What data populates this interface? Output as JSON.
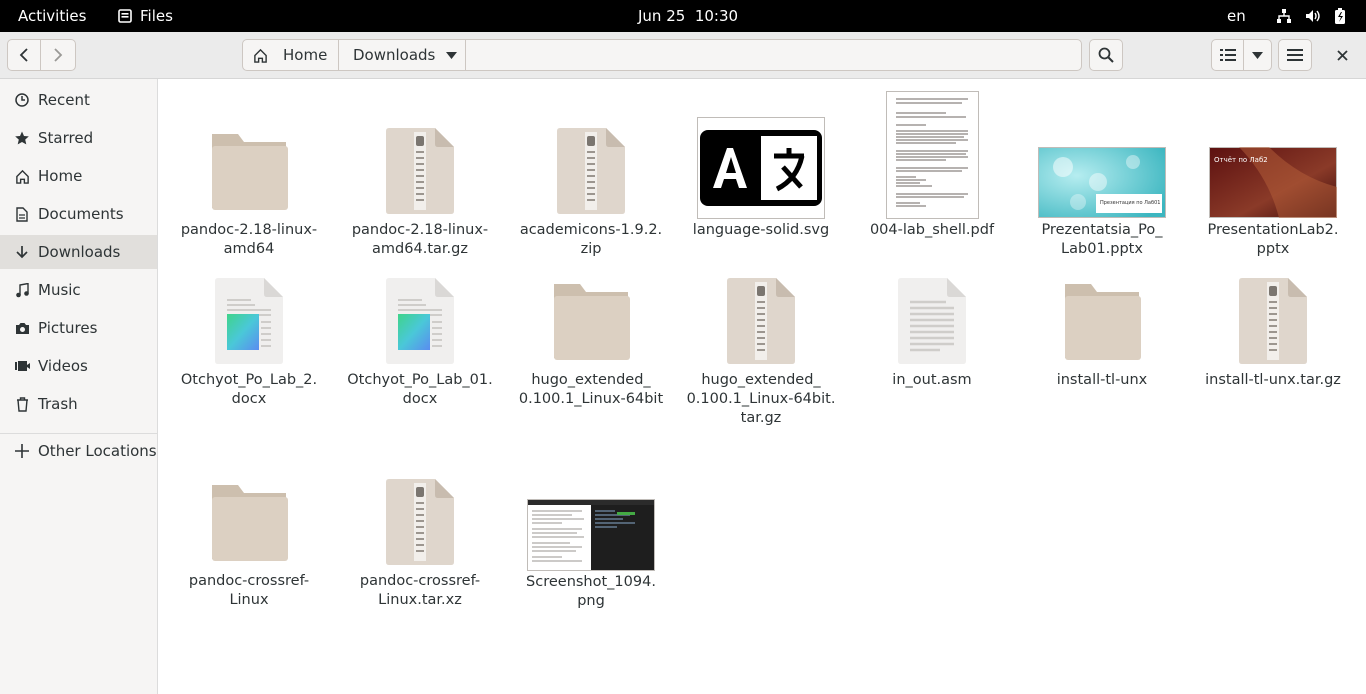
{
  "topbar": {
    "activities": "Activities",
    "app_name": "Files",
    "clock": "Jun 25  10:30",
    "language": "en"
  },
  "header": {
    "path": [
      "Home",
      "Downloads"
    ]
  },
  "sidebar": {
    "items": [
      {
        "label": "Recent",
        "icon": "clock-icon"
      },
      {
        "label": "Starred",
        "icon": "star-icon"
      },
      {
        "label": "Home",
        "icon": "home-icon"
      },
      {
        "label": "Documents",
        "icon": "document-icon"
      },
      {
        "label": "Downloads",
        "icon": "download-icon",
        "active": true
      },
      {
        "label": "Music",
        "icon": "music-icon"
      },
      {
        "label": "Pictures",
        "icon": "camera-icon"
      },
      {
        "label": "Videos",
        "icon": "video-icon"
      },
      {
        "label": "Trash",
        "icon": "trash-icon"
      }
    ],
    "other_locations": "Other Locations"
  },
  "files": [
    {
      "name": "pandoc-2.18-linux-\namd64",
      "type": "folder"
    },
    {
      "name": "pandoc-2.18-linux-\namd64.tar.gz",
      "type": "archive"
    },
    {
      "name": "academicons-1.9.2.\nzip",
      "type": "archive"
    },
    {
      "name": "language-solid.svg",
      "type": "svg"
    },
    {
      "name": "004-lab_shell.pdf",
      "type": "pdf"
    },
    {
      "name": "Prezentatsia_Po_\nLab01.pptx",
      "type": "pptx-blue"
    },
    {
      "name": "PresentationLab2.\npptx",
      "type": "pptx-red"
    },
    {
      "name": "Otchyot_Po_Lab_2.\ndocx",
      "type": "docx"
    },
    {
      "name": "Otchyot_Po_Lab_01.\ndocx",
      "type": "docx"
    },
    {
      "name": "hugo_extended_\n0.100.1_Linux-64bit",
      "type": "folder"
    },
    {
      "name": "hugo_extended_\n0.100.1_Linux-64bit.\ntar.gz",
      "type": "archive"
    },
    {
      "name": "in_out.asm",
      "type": "text"
    },
    {
      "name": "install-tl-unx",
      "type": "folder"
    },
    {
      "name": "install-tl-unx.tar.gz",
      "type": "archive"
    },
    {
      "name": "pandoc-crossref-\nLinux",
      "type": "folder"
    },
    {
      "name": "pandoc-crossref-\nLinux.tar.xz",
      "type": "archive"
    },
    {
      "name": "Screenshot_1094.\npng",
      "type": "png"
    }
  ],
  "thumbnails": {
    "pptx_red_title": "Отчёт по Лаб2",
    "pptx_blue_caption": "Презентация по Лаб01"
  },
  "colors": {
    "folder": "#d5c8b8",
    "archive": "#e0d7cd",
    "active_sidebar": "#e1dfdc"
  }
}
